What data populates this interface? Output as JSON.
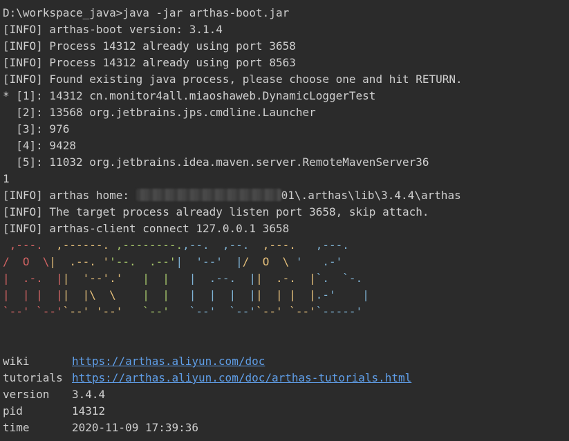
{
  "terminal": {
    "lines": [
      "D:\\workspace_java>java -jar arthas-boot.jar",
      "[INFO] arthas-boot version: 3.1.4",
      "[INFO] Process 14312 already using port 3658",
      "[INFO] Process 14312 already using port 8563",
      "[INFO] Found existing java process, please choose one and hit RETURN.",
      "* [1]: 14312 cn.monitor4all.miaoshaweb.DynamicLoggerTest",
      "  [2]: 13568 org.jetbrains.jps.cmdline.Launcher",
      "  [3]: 976",
      "  [4]: 9428",
      "  [5]: 11032 org.jetbrains.idea.maven.server.RemoteMavenServer36",
      "1"
    ],
    "home_line": {
      "prefix": "[INFO] arthas home: ",
      "suffix": "01\\.arthas\\lib\\3.4.4\\arthas"
    },
    "after_lines": [
      "[INFO] The target process already listen port 3658, skip attach.",
      "[INFO] arthas-client connect 127.0.0.1 3658"
    ],
    "banner": {
      "colors": {
        "c1": "#d46464",
        "c2": "#e6c07b",
        "c3": "#a8c96c",
        "c4": "#7fb3d5",
        "c5": "#9a8fe0"
      },
      "rows": [
        [
          " ,---. ",
          " ,------. ",
          ",--------.",
          ",--.  ,--. ",
          " ,---.  ",
          " ,---. "
        ],
        [
          "/  O  \\",
          "|  .--. '",
          "'--.  .--'",
          "|  '--'  |",
          "/  O  \\ ",
          "'   .-'"
        ],
        [
          "|  .-.  |",
          "|  '--'.'",
          "   |  |   ",
          "|  .--.  |",
          "|  .-.  |",
          "`.  `-."
        ],
        [
          "|  | |  |",
          "|  |\\  \\ ",
          "   |  |   ",
          "|  |  |  |",
          "|  | |  |",
          ".-'    |"
        ],
        [
          "`--' `--'",
          "`--' '--'",
          "   `--'   ",
          "`--'  `--'",
          "`--' `--'",
          "`-----' "
        ]
      ]
    },
    "info": {
      "wiki": {
        "key": "wiki",
        "value": "https://arthas.aliyun.com/doc"
      },
      "tutorials": {
        "key": "tutorials",
        "value": "https://arthas.aliyun.com/doc/arthas-tutorials.html"
      },
      "version": {
        "key": "version",
        "value": "3.4.4"
      },
      "pid": {
        "key": "pid",
        "value": "14312"
      },
      "time": {
        "key": "time",
        "value": "2020-11-09 17:39:36"
      }
    }
  }
}
